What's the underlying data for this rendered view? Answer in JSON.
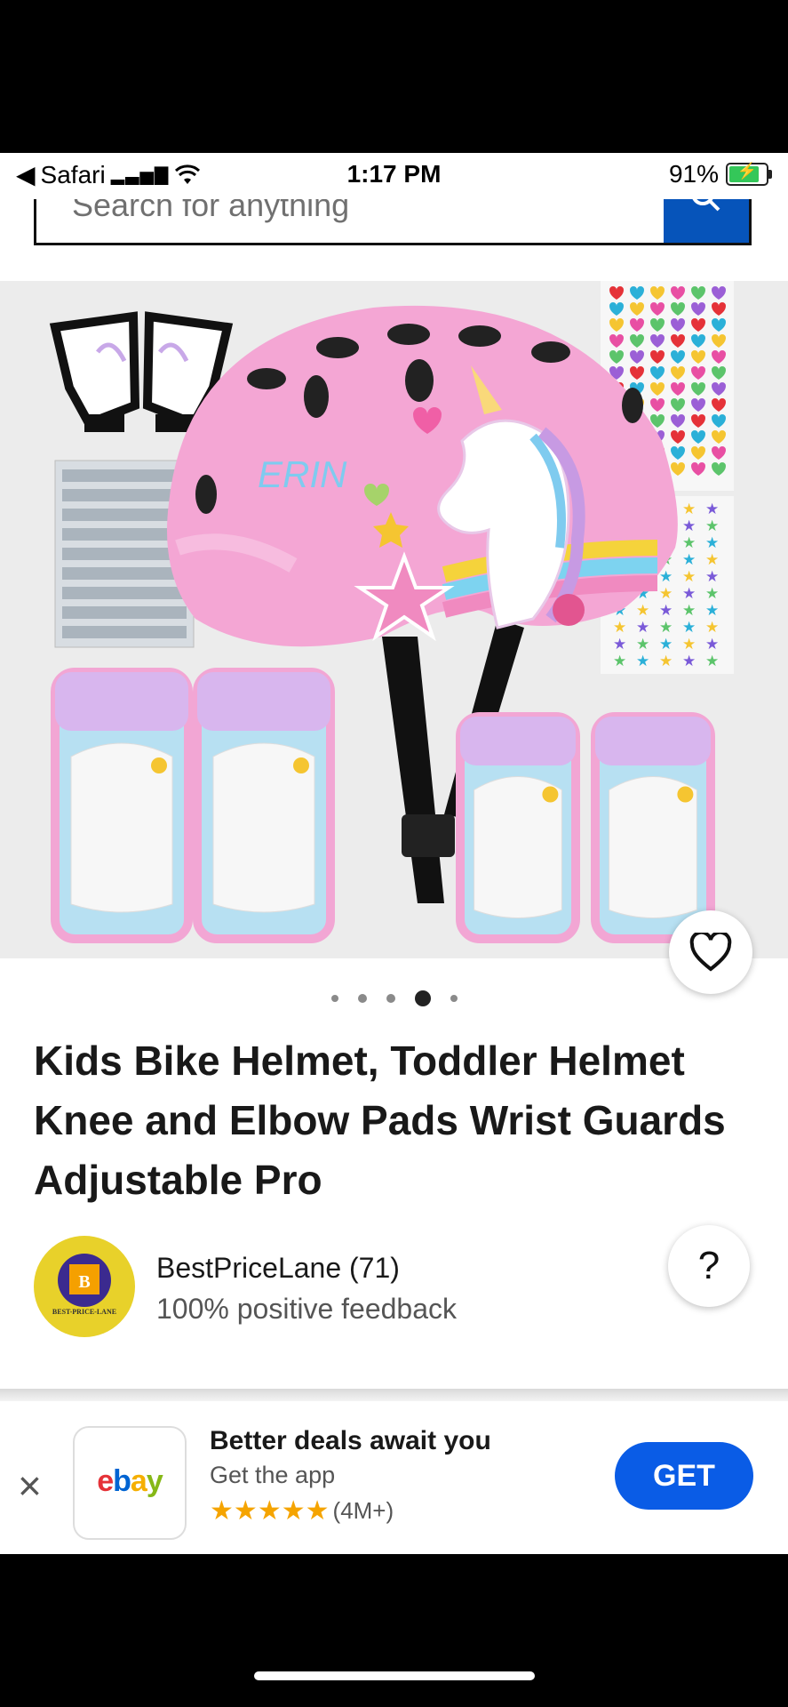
{
  "status": {
    "back_app": "Safari",
    "time": "1:17 PM",
    "battery": "91%",
    "battery_level": 0.91
  },
  "search": {
    "placeholder": "Search for anything"
  },
  "gallery": {
    "helmet_name_text": "ERIN",
    "image_count": 5,
    "active_index": 3
  },
  "product": {
    "title": "Kids Bike Helmet, Toddler Helmet Knee and Elbow Pads Wrist Guards Adjustable Pro"
  },
  "seller": {
    "name": "BestPriceLane (71)",
    "feedback": "100% positive feedback",
    "logo_text": "BEST-PRICE-LANE"
  },
  "help": {
    "label": "?"
  },
  "app_banner": {
    "close_label": "×",
    "app_name": "ebay",
    "title": "Better deals await you",
    "subtitle": "Get the app",
    "rating_count": "(4M+)",
    "stars": 5,
    "get_label": "GET"
  },
  "colors": {
    "ebay_blue": "#0654ba",
    "get_button": "#0a5ce6",
    "star": "#f5a400",
    "helmet_pink": "#f4a6d4"
  }
}
